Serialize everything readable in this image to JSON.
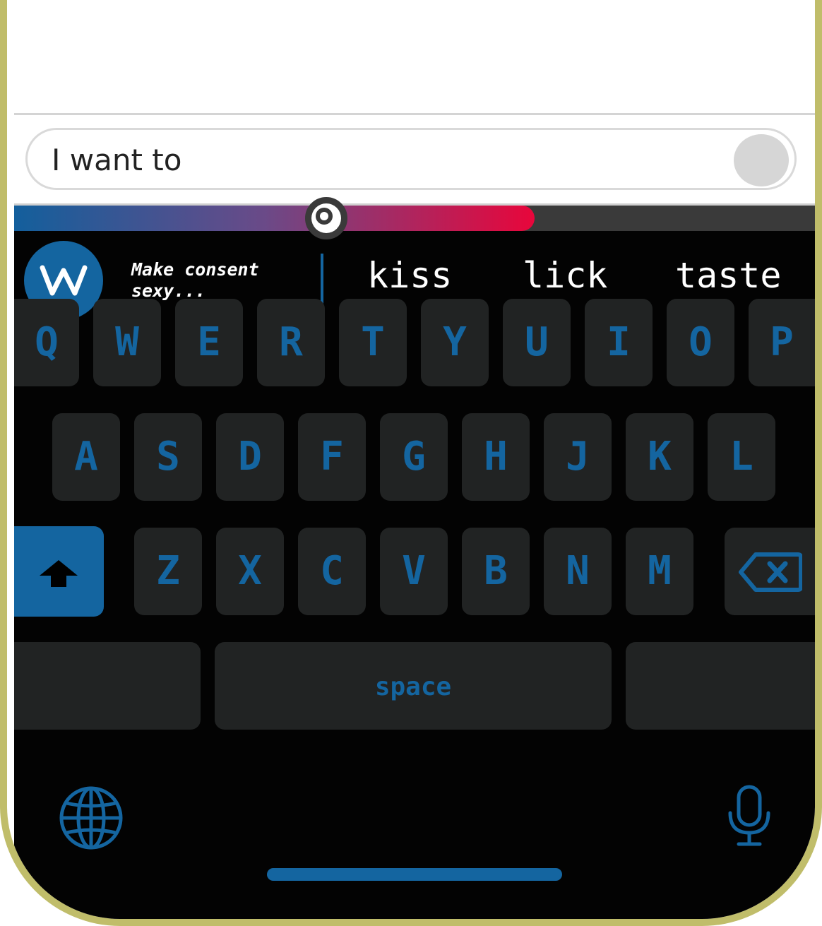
{
  "composer": {
    "text": "I want to"
  },
  "meter": {
    "level_fraction": 0.65,
    "gradient_colors": [
      "#135f9c",
      "#6a4a88",
      "#e8063b"
    ]
  },
  "brand": {
    "tagline": "Make consent sexy...",
    "logo_icon": "wm-monogram-icon",
    "accent": "#1465a0"
  },
  "suggestions": [
    "kiss",
    "lick",
    "taste"
  ],
  "keyboard": {
    "row1": [
      "Q",
      "W",
      "E",
      "R",
      "T",
      "Y",
      "U",
      "I",
      "O",
      "P"
    ],
    "row2": [
      "A",
      "S",
      "D",
      "F",
      "G",
      "H",
      "J",
      "K",
      "L"
    ],
    "row3": [
      "Z",
      "X",
      "C",
      "V",
      "B",
      "N",
      "M"
    ],
    "space_label": "space",
    "icons": {
      "shift": "shift-arrow-icon",
      "backspace": "backspace-icon",
      "globe": "globe-icon",
      "mic": "microphone-icon"
    }
  }
}
